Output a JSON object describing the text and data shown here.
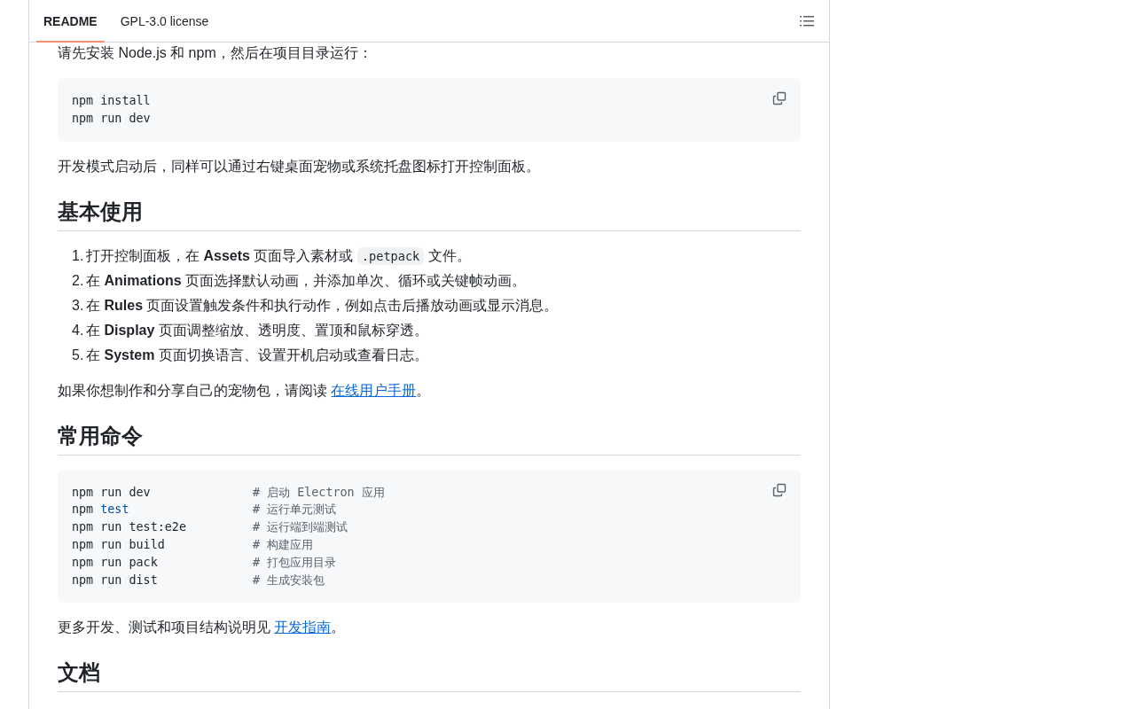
{
  "tabs": [
    {
      "label": "README",
      "selected": true
    },
    {
      "label": "GPL-3.0 license",
      "selected": false
    }
  ],
  "content": [
    {
      "kind": "paragraph",
      "segments": [
        {
          "kind": "text",
          "text": "请先安装 Node.js 和 npm，然后在项目目录运行："
        }
      ]
    },
    {
      "kind": "code",
      "lines": [
        {
          "command": [
            {
              "kind": "plain",
              "text": "npm install"
            }
          ]
        },
        {
          "command": [
            {
              "kind": "plain",
              "text": "npm run dev"
            }
          ]
        }
      ]
    },
    {
      "kind": "paragraph",
      "segments": [
        {
          "kind": "text",
          "text": "开发模式启动后，同样可以通过右键桌面宠物或系统托盘图标打开控制面板。"
        }
      ]
    },
    {
      "kind": "heading",
      "text": "基本使用"
    },
    {
      "kind": "list",
      "items": [
        {
          "number": "1.",
          "segments": [
            {
              "kind": "text",
              "text": "打开控制面板，在 **Assets** 页面导入素材或 "
            },
            {
              "kind": "code",
              "text": ".petpack"
            },
            {
              "kind": "text",
              "text": " 文件。"
            }
          ]
        },
        {
          "number": "2.",
          "segments": [
            {
              "kind": "text",
              "text": "在 **Animations** 页面选择默认动画，并添加单次、循环或关键帧动画。"
            }
          ]
        },
        {
          "number": "3.",
          "segments": [
            {
              "kind": "text",
              "text": "在 **Rules** 页面设置触发条件和执行动作，例如点击后播放动画或显示消息。"
            }
          ]
        },
        {
          "number": "4.",
          "segments": [
            {
              "kind": "text",
              "text": "在 **Display** 页面调整缩放、透明度、置顶和鼠标穿透。"
            }
          ]
        },
        {
          "number": "5.",
          "segments": [
            {
              "kind": "text",
              "text": "在 **System** 页面切换语言、设置开机启动或查看日志。"
            }
          ]
        }
      ]
    },
    {
      "kind": "paragraph",
      "segments": [
        {
          "kind": "text",
          "text": "如果你想制作和分享自己的宠物包，请阅读 "
        },
        {
          "kind": "link",
          "text": "在线用户手册"
        },
        {
          "kind": "text",
          "text": "。"
        }
      ]
    },
    {
      "kind": "heading",
      "text": "常用命令"
    },
    {
      "kind": "code",
      "lines": [
        {
          "command": [
            {
              "kind": "plain",
              "text": "npm run dev"
            }
          ],
          "comment": "# 启动 Electron 应用"
        },
        {
          "command": [
            {
              "kind": "plain",
              "text": "npm "
            },
            {
              "kind": "builtin",
              "text": "test"
            }
          ],
          "comment": "# 运行单元测试"
        },
        {
          "command": [
            {
              "kind": "plain",
              "text": "npm run test:e2e"
            }
          ],
          "comment": "# 运行端到端测试"
        },
        {
          "command": [
            {
              "kind": "plain",
              "text": "npm run build"
            }
          ],
          "comment": "# 构建应用"
        },
        {
          "command": [
            {
              "kind": "plain",
              "text": "npm run pack"
            }
          ],
          "comment": "# 打包应用目录"
        },
        {
          "command": [
            {
              "kind": "plain",
              "text": "npm run dist"
            }
          ],
          "comment": "# 生成安装包"
        }
      ]
    },
    {
      "kind": "paragraph",
      "segments": [
        {
          "kind": "text",
          "text": "更多开发、测试和项目结构说明见 "
        },
        {
          "kind": "link",
          "text": "开发指南"
        },
        {
          "kind": "text",
          "text": "。"
        }
      ]
    },
    {
      "kind": "heading",
      "text": "文档"
    }
  ]
}
